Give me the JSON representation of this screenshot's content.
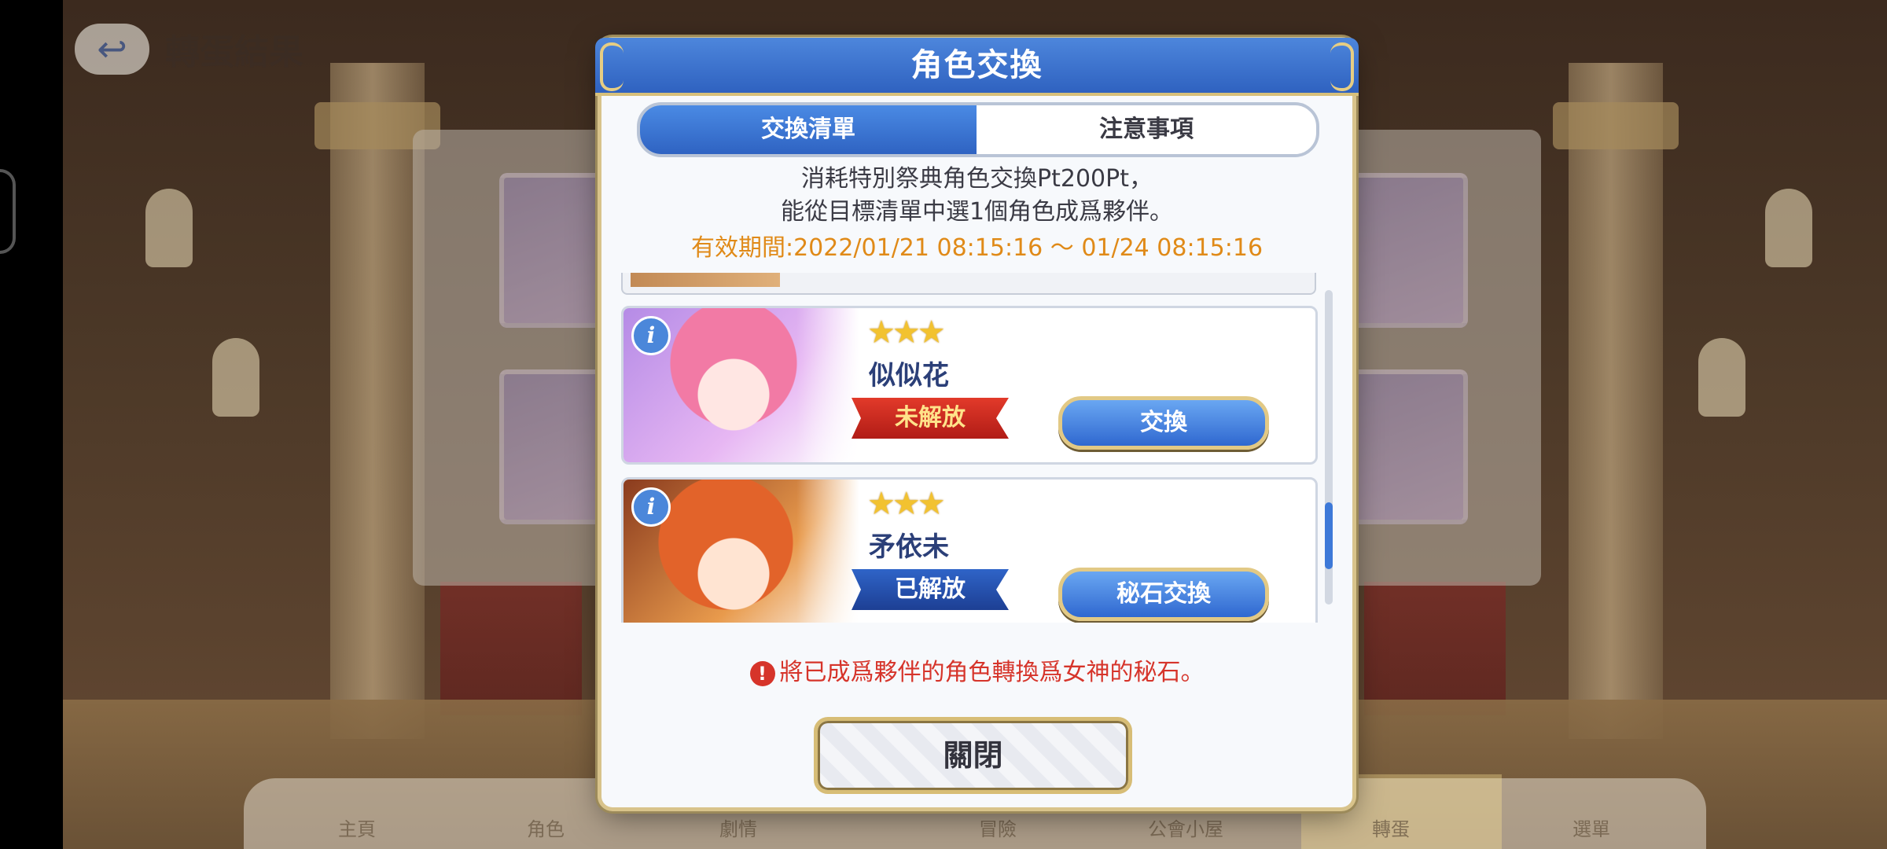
{
  "screen": {
    "title": "轉蛋結果",
    "back_icon": "back-arrow-icon",
    "nav_items": [
      "主頁",
      "角色",
      "劇情",
      "冒險",
      "公會小屋",
      "轉蛋",
      "選單"
    ]
  },
  "dialog": {
    "title": "角色交換",
    "tabs": [
      {
        "label": "交換清單",
        "active": true
      },
      {
        "label": "注意事項",
        "active": false
      }
    ],
    "description_line1": "消耗特別祭典角色交換Pt200Pt，",
    "description_line2": "能從目標清單中選1個角色成爲夥伴。",
    "period_label": "有效期間:",
    "period_value": "2022/01/21 08:15:16 ～ 01/24 08:15:16",
    "entries": [
      {
        "stars": "★★★",
        "rarity": 3,
        "name": "似似花",
        "status": "未解放",
        "status_color": "#c8231b",
        "button": "交換",
        "info_icon": "info-icon"
      },
      {
        "stars": "★★★",
        "rarity": 3,
        "name": "矛依未",
        "status": "已解放",
        "status_color": "#2449a6",
        "button": "秘石交換",
        "info_icon": "info-icon"
      }
    ],
    "notice_icon": "!",
    "notice": "將已成爲夥伴的角色轉換爲女神的秘石。",
    "close_label": "關閉"
  },
  "colors": {
    "header_blue": "#2f62c0",
    "accent_gold": "#d7c07b",
    "period_orange": "#e08a18",
    "notice_red": "#d6342a"
  }
}
